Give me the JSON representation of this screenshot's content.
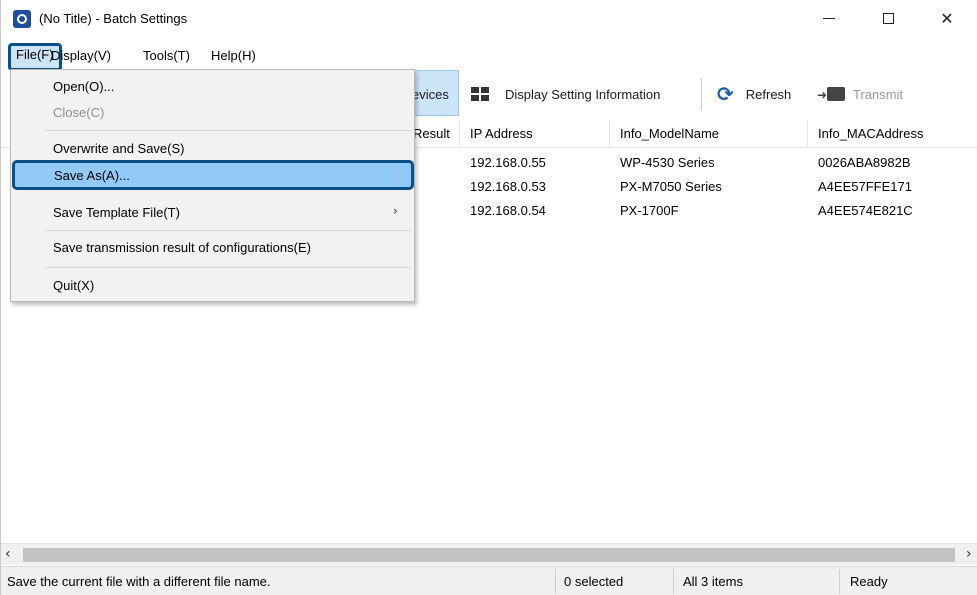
{
  "window": {
    "title": "(No Title) - Batch Settings",
    "icon": "app-globe-icon"
  },
  "menubar": {
    "file": "File(F)",
    "display": "Display(V)",
    "tools": "Tools(T)",
    "help": "Help(H)"
  },
  "toolbar": {
    "devices_partial": "evices",
    "display_setting_information": "Display Setting Information",
    "refresh": "Refresh",
    "transmit": "Transmit"
  },
  "table": {
    "headers": {
      "result_partial": "Result",
      "ip": "IP Address",
      "model": "Info_ModelName",
      "mac": "Info_MACAddress"
    },
    "rows": [
      {
        "ip": "192.168.0.55",
        "model": "WP-4530 Series",
        "mac": "0026ABA8982B"
      },
      {
        "ip": "192.168.0.53",
        "model": "PX-M7050 Series",
        "mac": "A4EE57FFE171"
      },
      {
        "ip": "192.168.0.54",
        "model": "PX-1700F",
        "mac": "A4EE574E821C"
      }
    ]
  },
  "file_menu": {
    "open": "Open(O)...",
    "close": "Close(C)",
    "overwrite_save": "Overwrite and Save(S)",
    "save_as": "Save As(A)...",
    "save_template": "Save Template File(T)",
    "save_transmission": "Save transmission result of configurations(E)",
    "quit": "Quit(X)"
  },
  "statusbar": {
    "message": "Save the current file with a different file name.",
    "selected": "0 selected",
    "items": "All 3 items",
    "state": "Ready"
  },
  "colors": {
    "highlight_border": "#0b4f8a",
    "highlight_fill": "#91c9f7",
    "toolbar_selected": "#cce4f7"
  }
}
